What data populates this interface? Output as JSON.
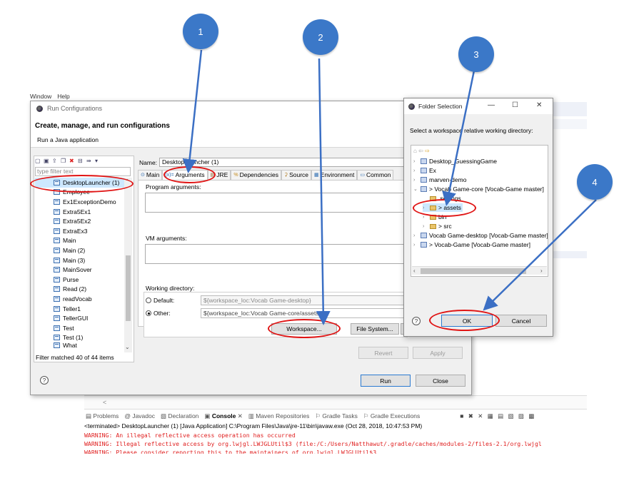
{
  "ide_menu": [
    "Window",
    "Help"
  ],
  "run_dialog": {
    "title": "Run Configurations",
    "heading": "Create, manage, and run configurations",
    "subheading": "Run a Java application",
    "filter_placeholder": "type filter text",
    "tree_items": [
      "DesktopLauncher (1)",
      "Employee",
      "Ex1ExceptionDemo",
      "Extra5Ex1",
      "Extra5Ex2",
      "ExtraEx3",
      "Main",
      "Main (2)",
      "Main (3)",
      "MainSover",
      "Purse",
      "Read (2)",
      "readVocab",
      "Teller1",
      "TellerGUI",
      "Test",
      "Test (1)",
      "What"
    ],
    "selected_item": "DesktopLauncher (1)",
    "filter_count": "Filter matched 40 of 44 items",
    "name_label": "Name:",
    "name_value": "DesktopLauncher (1)",
    "tabs": [
      {
        "label": "Main",
        "icon": "main-icon"
      },
      {
        "label": "Arguments",
        "icon": "arguments-icon",
        "prefix": "(x)="
      },
      {
        "label": "JRE",
        "icon": "jre-icon"
      },
      {
        "label": "Dependencies",
        "icon": "dependencies-icon"
      },
      {
        "label": "Source",
        "icon": "source-icon"
      },
      {
        "label": "Environment",
        "icon": "environment-icon"
      },
      {
        "label": "Common",
        "icon": "common-icon"
      }
    ],
    "active_tab": "Arguments",
    "program_args_label": "Program arguments:",
    "vm_args_label": "VM arguments:",
    "working_dir_label": "Working directory:",
    "default_label": "Default:",
    "default_value": "${workspace_loc:Vocab Game-desktop}",
    "other_label": "Other:",
    "other_value": "${workspace_loc:Vocab Game-core/assets",
    "workspace_button": "Workspace...",
    "filesystem_button": "File System...",
    "revert_button": "Revert",
    "apply_button": "Apply",
    "run_button": "Run",
    "close_button": "Close",
    "help_glyph": "?"
  },
  "folder_dialog": {
    "title": "Folder Selection",
    "minimize": "—",
    "maximize": "☐",
    "close": "✕",
    "prompt": "Select a workspace relative working directory:",
    "items": [
      {
        "label": "Desktop_GuessingGame",
        "chev": "›",
        "kind": "project"
      },
      {
        "label": "Ex",
        "chev": "›",
        "kind": "project"
      },
      {
        "label": "marven-demo",
        "chev": "›",
        "kind": "project"
      },
      {
        "label": "> Vocab Game-core [Vocab-Game master]",
        "chev": "⌄",
        "kind": "project"
      },
      {
        "label": ".settings",
        "chev": "",
        "kind": "folder"
      },
      {
        "label": "> assets",
        "chev": "›",
        "kind": "folder"
      },
      {
        "label": "bin",
        "chev": "›",
        "kind": "folder"
      },
      {
        "label": "> src",
        "chev": "›",
        "kind": "folder"
      },
      {
        "label": "Vocab Game-desktop [Vocab-Game master]",
        "chev": "›",
        "kind": "project"
      },
      {
        "label": "> Vocab-Game [Vocab-Game master]",
        "chev": "›",
        "kind": "project"
      }
    ],
    "ok_button": "OK",
    "cancel_button": "Cancel",
    "help_glyph": "?"
  },
  "console": {
    "tabs": [
      "Problems",
      "Javadoc",
      "Declaration",
      "Console",
      "Maven Repositories",
      "Gradle Tasks",
      "Gradle Executions"
    ],
    "active_tab": "Console",
    "terminated": "<terminated> DesktopLauncher (1) [Java Application] C:\\Program Files\\Java\\jre-11\\bin\\javaw.exe (Oct 28, 2018, 10:47:53 PM)",
    "lines": [
      "WARNING: An illegal reflective access operation has occurred",
      "WARNING: Illegal reflective access by org.lwjgl.LWJGLUtil$3 (file:/C:/Users/Natthawut/.gradle/caches/modules-2/files-2.1/org.lwjgl",
      "WARNING: Please consider reporting this to the maintainers of org.lwjgl.LWJGLUtil$3"
    ],
    "scroll_left": "<"
  },
  "annotations": [
    "1",
    "2",
    "3",
    "4"
  ],
  "colors": {
    "callout": "#3b78c8",
    "ring": "#e01414",
    "warning": "#e02020",
    "selection": "#cde8ff"
  }
}
